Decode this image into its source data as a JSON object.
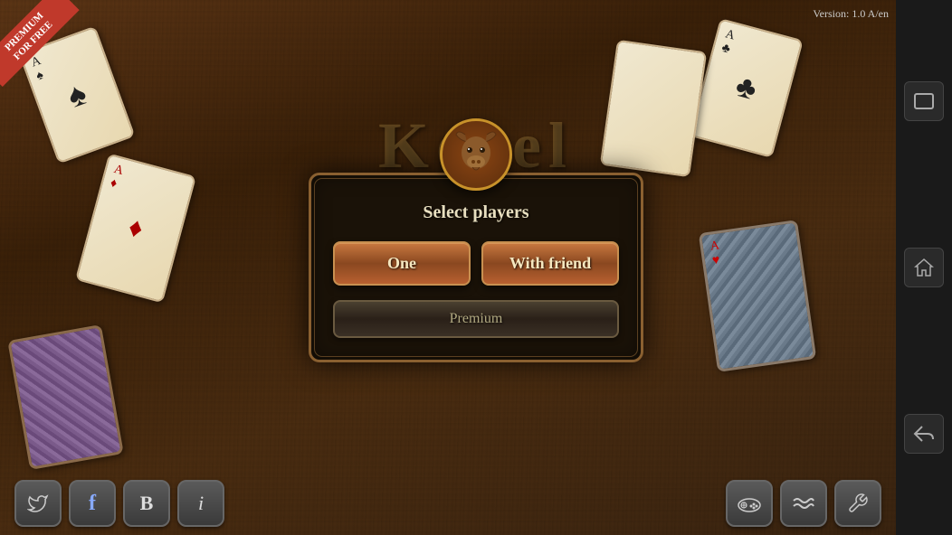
{
  "version": "Version: 1.0 A/en",
  "premium_badge": {
    "line1": "PREMIUM",
    "line2": "FOR FREE"
  },
  "dialog": {
    "title": "Select players",
    "btn_one": "One",
    "btn_friend": "With friend",
    "btn_premium": "Premium"
  },
  "sidebar": {
    "btn_window": "⬜",
    "btn_home": "⌂",
    "btn_back": "↩"
  },
  "toolbar": {
    "btn_twitter": "𝕏",
    "btn_facebook": "f",
    "btn_bold": "B",
    "btn_info": "i",
    "btn_gamepad": "🎮",
    "btn_wave": "〜",
    "btn_tools": "✂"
  },
  "cards": [
    {
      "rank": "A",
      "suit": "♠",
      "color": "black"
    },
    {
      "rank": "A",
      "suit": "♣",
      "color": "black"
    },
    {
      "rank": "A",
      "suit": "♥",
      "color": "red"
    }
  ]
}
